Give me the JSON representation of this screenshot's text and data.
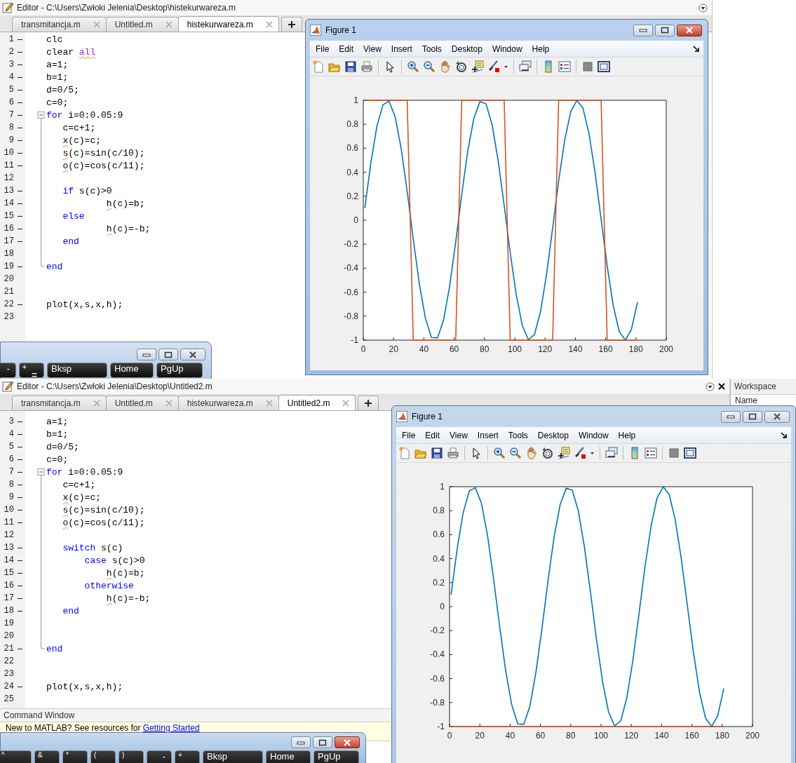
{
  "editors": [
    {
      "title": "Editor - C:\\Users\\Zwłoki Jelenia\\Desktop\\histekurwareza.m",
      "tabs": [
        {
          "label": "transmitancja.m",
          "selected": false
        },
        {
          "label": "Untitled.m",
          "selected": false
        },
        {
          "label": "histekurwareza.m",
          "selected": true
        }
      ],
      "lines": [
        {
          "number": "1",
          "executable": true,
          "fold_start": false,
          "fold_end": false,
          "segments": [
            {
              "kind": "plain",
              "text": "clc"
            }
          ]
        },
        {
          "number": "2",
          "executable": true,
          "fold_start": false,
          "fold_end": false,
          "segments": [
            {
              "kind": "plain",
              "text": "clear "
            },
            {
              "kind": "flagged-string",
              "text": "all"
            }
          ]
        },
        {
          "number": "3",
          "executable": true,
          "fold_start": false,
          "fold_end": false,
          "segments": [
            {
              "kind": "plain",
              "text": "a=1;"
            }
          ]
        },
        {
          "number": "4",
          "executable": true,
          "fold_start": false,
          "fold_end": false,
          "segments": [
            {
              "kind": "plain",
              "text": "b=1;"
            }
          ]
        },
        {
          "number": "5",
          "executable": true,
          "fold_start": false,
          "fold_end": false,
          "segments": [
            {
              "kind": "plain",
              "text": "d=0/5;"
            }
          ]
        },
        {
          "number": "6",
          "executable": true,
          "fold_start": false,
          "fold_end": false,
          "segments": [
            {
              "kind": "plain",
              "text": "c=0;"
            }
          ]
        },
        {
          "number": "7",
          "executable": true,
          "fold_start": true,
          "fold_end": false,
          "segments": [
            {
              "kind": "keyword",
              "text": "for"
            },
            {
              "kind": "plain",
              "text": " i=0:0.05:9"
            }
          ]
        },
        {
          "number": "8",
          "executable": true,
          "fold_start": false,
          "fold_end": false,
          "segments": [
            {
              "kind": "plain",
              "text": "   c=c+1;"
            }
          ]
        },
        {
          "number": "9",
          "executable": true,
          "fold_start": false,
          "fold_end": false,
          "segments": [
            {
              "kind": "flagged",
              "text": "   x"
            },
            {
              "kind": "plain",
              "text": "(c)=c;"
            }
          ]
        },
        {
          "number": "10",
          "executable": true,
          "fold_start": false,
          "fold_end": false,
          "segments": [
            {
              "kind": "flagged",
              "text": "   s"
            },
            {
              "kind": "plain",
              "text": "(c)=sin(c/10);"
            }
          ]
        },
        {
          "number": "11",
          "executable": true,
          "fold_start": false,
          "fold_end": false,
          "segments": [
            {
              "kind": "flagged",
              "text": "   o"
            },
            {
              "kind": "plain",
              "text": "(c)=cos(c/11);"
            }
          ]
        },
        {
          "number": "12",
          "executable": false,
          "fold_start": false,
          "fold_end": false
        },
        {
          "number": "13",
          "executable": true,
          "fold_start": false,
          "fold_end": false,
          "segments": [
            {
              "kind": "keyword",
              "text": "   if"
            },
            {
              "kind": "plain",
              "text": " s(c)>0"
            }
          ]
        },
        {
          "number": "14",
          "executable": true,
          "fold_start": false,
          "fold_end": false,
          "segments": [
            {
              "kind": "flagged",
              "text": "           h"
            },
            {
              "kind": "plain",
              "text": "(c)=b;"
            }
          ]
        },
        {
          "number": "15",
          "executable": true,
          "fold_start": false,
          "fold_end": false,
          "segments": [
            {
              "kind": "keyword",
              "text": "   else"
            }
          ]
        },
        {
          "number": "16",
          "executable": true,
          "fold_start": false,
          "fold_end": false,
          "segments": [
            {
              "kind": "flagged",
              "text": "           h"
            },
            {
              "kind": "plain",
              "text": "(c)=-b;"
            }
          ]
        },
        {
          "number": "17",
          "executable": true,
          "fold_start": false,
          "fold_end": false,
          "segments": [
            {
              "kind": "keyword",
              "text": "   end"
            }
          ]
        },
        {
          "number": "18",
          "executable": false,
          "fold_start": false,
          "fold_end": false
        },
        {
          "number": "19",
          "executable": true,
          "fold_start": false,
          "fold_end": true,
          "segments": [
            {
              "kind": "keyword",
              "text": "end"
            }
          ]
        },
        {
          "number": "20",
          "executable": false,
          "fold_start": false,
          "fold_end": false
        },
        {
          "number": "21",
          "executable": false,
          "fold_start": false,
          "fold_end": false
        },
        {
          "number": "22",
          "executable": true,
          "fold_start": false,
          "fold_end": false,
          "segments": [
            {
              "kind": "plain",
              "text": "plot(x,s,x,h);"
            }
          ]
        },
        {
          "number": "23",
          "executable": false,
          "fold_start": false,
          "fold_end": false
        }
      ]
    },
    {
      "title": "Editor - C:\\Users\\Zwłoki Jelenia\\Desktop\\Untitled2.m",
      "tabs": [
        {
          "label": "transmitancja.m",
          "selected": false
        },
        {
          "label": "Untitled.m",
          "selected": false
        },
        {
          "label": "histekurwareza.m",
          "selected": false
        },
        {
          "label": "Untitled2.m",
          "selected": true
        }
      ],
      "lines": [
        {
          "number": "3",
          "executable": true,
          "fold_start": false,
          "fold_end": false,
          "segments": [
            {
              "kind": "plain",
              "text": "a=1;"
            }
          ]
        },
        {
          "number": "4",
          "executable": true,
          "fold_start": false,
          "fold_end": false,
          "segments": [
            {
              "kind": "plain",
              "text": "b=1;"
            }
          ]
        },
        {
          "number": "5",
          "executable": true,
          "fold_start": false,
          "fold_end": false,
          "segments": [
            {
              "kind": "plain",
              "text": "d=0/5;"
            }
          ]
        },
        {
          "number": "6",
          "executable": true,
          "fold_start": false,
          "fold_end": false,
          "segments": [
            {
              "kind": "plain",
              "text": "c=0;"
            }
          ]
        },
        {
          "number": "7",
          "executable": true,
          "fold_start": true,
          "fold_end": false,
          "segments": [
            {
              "kind": "keyword",
              "text": "for"
            },
            {
              "kind": "plain",
              "text": " i=0:0.05:9"
            }
          ]
        },
        {
          "number": "8",
          "executable": true,
          "fold_start": false,
          "fold_end": false,
          "segments": [
            {
              "kind": "plain",
              "text": "   c=c+1;"
            }
          ]
        },
        {
          "number": "9",
          "executable": true,
          "fold_start": false,
          "fold_end": false,
          "segments": [
            {
              "kind": "flagged",
              "text": "   x"
            },
            {
              "kind": "plain",
              "text": "(c)=c;"
            }
          ]
        },
        {
          "number": "10",
          "executable": true,
          "fold_start": false,
          "fold_end": false,
          "segments": [
            {
              "kind": "flagged",
              "text": "   s"
            },
            {
              "kind": "plain",
              "text": "(c)=sin(c/10);"
            }
          ]
        },
        {
          "number": "11",
          "executable": true,
          "fold_start": false,
          "fold_end": false,
          "segments": [
            {
              "kind": "flagged",
              "text": "   o"
            },
            {
              "kind": "plain",
              "text": "(c)=cos(c/11);"
            }
          ]
        },
        {
          "number": "12",
          "executable": false,
          "fold_start": false,
          "fold_end": false
        },
        {
          "number": "13",
          "executable": true,
          "fold_start": false,
          "fold_end": false,
          "segments": [
            {
              "kind": "keyword",
              "text": "   switch"
            },
            {
              "kind": "plain",
              "text": " s(c)"
            }
          ]
        },
        {
          "number": "14",
          "executable": true,
          "fold_start": false,
          "fold_end": false,
          "segments": [
            {
              "kind": "keyword",
              "text": "       case"
            },
            {
              "kind": "plain",
              "text": " s(c)>0"
            }
          ]
        },
        {
          "number": "15",
          "executable": true,
          "fold_start": false,
          "fold_end": false,
          "segments": [
            {
              "kind": "flagged",
              "text": "           h"
            },
            {
              "kind": "plain",
              "text": "(c)=b;"
            }
          ]
        },
        {
          "number": "16",
          "executable": true,
          "fold_start": false,
          "fold_end": false,
          "segments": [
            {
              "kind": "keyword",
              "text": "       otherwise"
            }
          ]
        },
        {
          "number": "17",
          "executable": true,
          "fold_start": false,
          "fold_end": false,
          "segments": [
            {
              "kind": "flagged",
              "text": "           h"
            },
            {
              "kind": "plain",
              "text": "(c)=-b;"
            }
          ]
        },
        {
          "number": "18",
          "executable": true,
          "fold_start": false,
          "fold_end": false,
          "segments": [
            {
              "kind": "keyword",
              "text": "   end"
            }
          ]
        },
        {
          "number": "19",
          "executable": false,
          "fold_start": false,
          "fold_end": false
        },
        {
          "number": "20",
          "executable": false,
          "fold_start": false,
          "fold_end": false
        },
        {
          "number": "21",
          "executable": true,
          "fold_start": false,
          "fold_end": true,
          "segments": [
            {
              "kind": "keyword",
              "text": "end"
            }
          ]
        },
        {
          "number": "22",
          "executable": false,
          "fold_start": false,
          "fold_end": false
        },
        {
          "number": "23",
          "executable": false,
          "fold_start": false,
          "fold_end": false
        },
        {
          "number": "24",
          "executable": true,
          "fold_start": false,
          "fold_end": false,
          "segments": [
            {
              "kind": "plain",
              "text": "plot(x,s,x,h);"
            }
          ]
        },
        {
          "number": "25",
          "executable": false,
          "fold_start": false,
          "fold_end": false
        }
      ]
    }
  ],
  "keyboards": [
    {
      "active": false,
      "keys": [
        {
          "label": "-"
        },
        {
          "top": "+",
          "label": "="
        },
        {
          "label": "Bksp"
        },
        {
          "label": "Home"
        },
        {
          "label": "PgUp"
        }
      ]
    },
    {
      "active": true,
      "keys": [
        {
          "top": "^"
        },
        {
          "top": "&"
        },
        {
          "top": "*"
        },
        {
          "top": "("
        },
        {
          "top": ")"
        },
        {
          "label": "-"
        },
        {
          "top": "+"
        },
        {
          "label": "Bksp"
        },
        {
          "label": "Home"
        },
        {
          "label": "PgUp"
        }
      ]
    }
  ],
  "figures": [
    {
      "title": "Figure 1",
      "active": true,
      "menu": [
        "File",
        "Edit",
        "View",
        "Insert",
        "Tools",
        "Desktop",
        "Window",
        "Help"
      ],
      "chart_data": {
        "type": "line",
        "xlim": [
          0,
          200
        ],
        "ylim": [
          -1,
          1
        ],
        "xticks": [
          0,
          20,
          40,
          60,
          80,
          100,
          120,
          140,
          160,
          180,
          200
        ],
        "yticks": [
          -1,
          -0.8,
          -0.6,
          -0.4,
          -0.2,
          0,
          0.2,
          0.4,
          0.6,
          0.8,
          1
        ],
        "x": [
          1,
          5,
          9,
          13,
          17,
          21,
          25,
          29,
          33,
          37,
          41,
          45,
          49,
          53,
          57,
          61,
          65,
          69,
          73,
          77,
          81,
          85,
          89,
          93,
          97,
          101,
          105,
          109,
          113,
          117,
          121,
          125,
          129,
          133,
          137,
          141,
          145,
          149,
          153,
          157,
          161,
          165,
          169,
          173,
          177,
          181
        ],
        "series": [
          {
            "color": "#0072bd",
            "values": [
              0.1,
              0.479,
              0.783,
              0.964,
              0.992,
              0.863,
              0.598,
              0.239,
              -0.158,
              -0.53,
              -0.818,
              -0.978,
              -0.982,
              -0.832,
              -0.551,
              -0.182,
              0.215,
              0.578,
              0.851,
              0.988,
              0.97,
              0.798,
              0.501,
              0.124,
              -0.272,
              -0.625,
              -0.88,
              -0.996,
              -0.954,
              -0.762,
              -0.449,
              -0.066,
              0.328,
              0.67,
              0.906,
              0.999,
              0.935,
              0.723,
              0.398,
              0.008,
              -0.382,
              -0.712,
              -0.929,
              -1,
              -0.912,
              -0.683
            ]
          },
          {
            "color": "#d95319",
            "values": [
              1,
              1,
              1,
              1,
              1,
              1,
              1,
              1,
              -1,
              -1,
              -1,
              -1,
              -1,
              -1,
              -1,
              -1,
              1,
              1,
              1,
              1,
              1,
              1,
              1,
              1,
              -1,
              -1,
              -1,
              -1,
              -1,
              -1,
              -1,
              -1,
              1,
              1,
              1,
              1,
              1,
              1,
              1,
              1,
              -1,
              -1,
              -1,
              -1,
              -1,
              -1
            ]
          }
        ]
      }
    },
    {
      "title": "Figure 1",
      "active": false,
      "menu": [
        "File",
        "Edit",
        "View",
        "Insert",
        "Tools",
        "Desktop",
        "Window",
        "Help"
      ],
      "chart_data": {
        "type": "line",
        "xlim": [
          0,
          200
        ],
        "ylim": [
          -1,
          1
        ],
        "xticks": [
          0,
          20,
          40,
          60,
          80,
          100,
          120,
          140,
          160,
          180,
          200
        ],
        "yticks": [
          -1,
          -0.8,
          -0.6,
          -0.4,
          -0.2,
          0,
          0.2,
          0.4,
          0.6,
          0.8,
          1
        ],
        "x": [
          1,
          5,
          9,
          13,
          17,
          21,
          25,
          29,
          33,
          37,
          41,
          45,
          49,
          53,
          57,
          61,
          65,
          69,
          73,
          77,
          81,
          85,
          89,
          93,
          97,
          101,
          105,
          109,
          113,
          117,
          121,
          125,
          129,
          133,
          137,
          141,
          145,
          149,
          153,
          157,
          161,
          165,
          169,
          173,
          177,
          181
        ],
        "series": [
          {
            "color": "#0072bd",
            "values": [
              0.1,
              0.479,
              0.783,
              0.964,
              0.992,
              0.863,
              0.598,
              0.239,
              -0.158,
              -0.53,
              -0.818,
              -0.978,
              -0.982,
              -0.832,
              -0.551,
              -0.182,
              0.215,
              0.578,
              0.851,
              0.988,
              0.97,
              0.798,
              0.501,
              0.124,
              -0.272,
              -0.625,
              -0.88,
              -0.996,
              -0.954,
              -0.762,
              -0.449,
              -0.066,
              0.328,
              0.67,
              0.906,
              0.999,
              0.935,
              0.723,
              0.398,
              0.008,
              -0.382,
              -0.712,
              -0.929,
              -1,
              -0.912,
              -0.683
            ]
          },
          {
            "color": "#d95319",
            "values": [
              -1,
              -1,
              -1,
              -1,
              -1,
              -1,
              -1,
              -1,
              -1,
              -1,
              -1,
              -1,
              -1,
              -1,
              -1,
              -1,
              -1,
              -1,
              -1,
              -1,
              -1,
              -1,
              -1,
              -1,
              -1,
              -1,
              -1,
              -1,
              -1,
              -1,
              -1,
              -1,
              -1,
              -1,
              -1,
              -1,
              -1,
              -1,
              -1,
              -1,
              -1,
              -1,
              -1,
              -1,
              -1,
              -1
            ]
          }
        ]
      }
    }
  ],
  "workspace": {
    "title": "Workspace",
    "column": "Name"
  },
  "command_window": {
    "title": "Command Window",
    "message": "New to MATLAB? See resources for",
    "link": "Getting Started"
  }
}
